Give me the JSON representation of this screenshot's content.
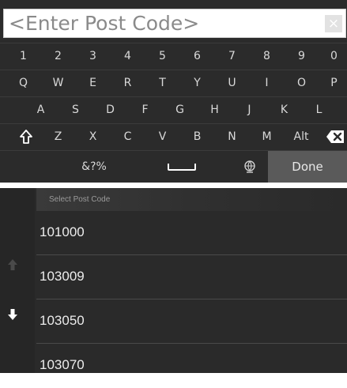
{
  "keyboard": {
    "input_placeholder": "<Enter Post Code>",
    "clear_symbol": "×",
    "rows": [
      [
        "1",
        "2",
        "3",
        "4",
        "5",
        "6",
        "7",
        "8",
        "9",
        "0"
      ],
      [
        "Q",
        "W",
        "E",
        "R",
        "T",
        "Y",
        "U",
        "I",
        "O",
        "P"
      ],
      [
        "A",
        "S",
        "D",
        "F",
        "G",
        "H",
        "J",
        "K",
        "L"
      ],
      [
        "Z",
        "X",
        "C",
        "V",
        "B",
        "N",
        "M",
        "Alt"
      ]
    ],
    "symbols_label": "&?%",
    "done_label": "Done",
    "icons": {
      "shift": "shift-arrow-icon",
      "backspace": "backspace-icon",
      "space": "space-bar-icon",
      "globe": "globe-language-icon"
    }
  },
  "list": {
    "title": "Select Post Code",
    "items": [
      "101000",
      "103009",
      "103050",
      "103070"
    ],
    "icons": {
      "up": "scroll-up-arrow-icon",
      "down": "scroll-down-arrow-icon"
    }
  },
  "colors": {
    "panel_bg": "#2b2b2b",
    "key_text": "#d9d9d9",
    "done_bg": "#5a5a5a",
    "list_text": "#ececec"
  }
}
